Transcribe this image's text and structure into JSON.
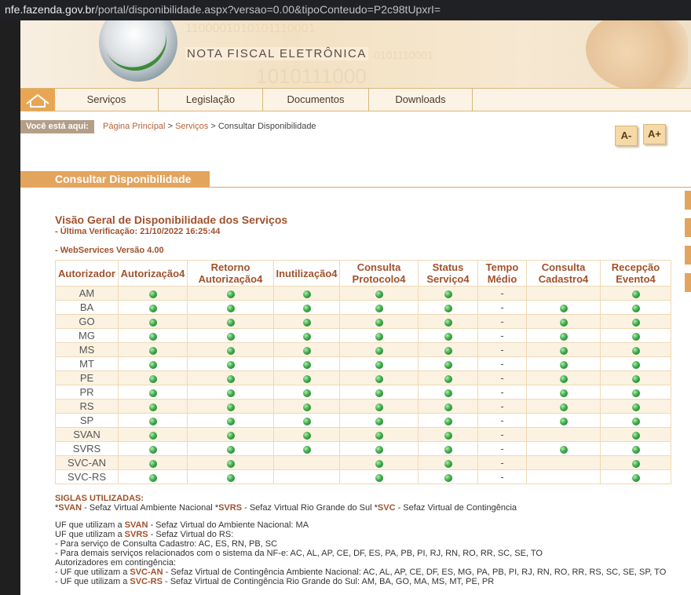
{
  "browser": {
    "url_domain": "nfe.fazenda.gov.br",
    "url_path": "/portal/disponibilidade.aspx?versao=0.00&tipoConteudo=P2c98tUpxrI="
  },
  "banner": {
    "title": "NOTA FISCAL ELETRÔNICA",
    "binary_1": "1100001010101110001",
    "binary_2": "0101110001",
    "binary_3": "1010111000"
  },
  "nav": {
    "home_icon": "house-icon",
    "items": [
      "Serviços",
      "Legislação",
      "Documentos",
      "Downloads"
    ]
  },
  "breadcrumb": {
    "label": "Você está aqui:",
    "links": [
      "Página Principal",
      "Serviços"
    ],
    "separator": ">",
    "current": "Consultar Disponibilidade"
  },
  "font_controls": {
    "decrease": "A-",
    "increase": "A+"
  },
  "section": {
    "title": "Consultar Disponibilidade"
  },
  "overview": {
    "heading": "Visão Geral de Disponibilidade dos Serviços",
    "last_check": "- Última Verificação: 21/10/2022 16:25:44",
    "version": "- WebServices Versão 4.00"
  },
  "table": {
    "headers": [
      "Autorizador",
      "Autorização4",
      "Retorno Autorização4",
      "Inutilização4",
      "Consulta Protocolo4",
      "Status Serviço4",
      "Tempo Médio",
      "Consulta Cadastro4",
      "Recepção Evento4"
    ],
    "rows": [
      {
        "uf": "AM",
        "cells": [
          "ok",
          "ok",
          "ok",
          "ok",
          "ok",
          "-",
          "",
          "ok"
        ]
      },
      {
        "uf": "BA",
        "cells": [
          "ok",
          "ok",
          "ok",
          "ok",
          "ok",
          "-",
          "ok",
          "ok"
        ]
      },
      {
        "uf": "GO",
        "cells": [
          "ok",
          "ok",
          "ok",
          "ok",
          "ok",
          "-",
          "ok",
          "ok"
        ]
      },
      {
        "uf": "MG",
        "cells": [
          "ok",
          "ok",
          "ok",
          "ok",
          "ok",
          "-",
          "ok",
          "ok"
        ]
      },
      {
        "uf": "MS",
        "cells": [
          "ok",
          "ok",
          "ok",
          "ok",
          "ok",
          "-",
          "ok",
          "ok"
        ]
      },
      {
        "uf": "MT",
        "cells": [
          "ok",
          "ok",
          "ok",
          "ok",
          "ok",
          "-",
          "ok",
          "ok"
        ]
      },
      {
        "uf": "PE",
        "cells": [
          "ok",
          "ok",
          "ok",
          "ok",
          "ok",
          "-",
          "ok",
          "ok"
        ]
      },
      {
        "uf": "PR",
        "cells": [
          "ok",
          "ok",
          "ok",
          "ok",
          "ok",
          "-",
          "ok",
          "ok"
        ]
      },
      {
        "uf": "RS",
        "cells": [
          "ok",
          "ok",
          "ok",
          "ok",
          "ok",
          "-",
          "ok",
          "ok"
        ]
      },
      {
        "uf": "SP",
        "cells": [
          "ok",
          "ok",
          "ok",
          "ok",
          "ok",
          "-",
          "ok",
          "ok"
        ]
      },
      {
        "uf": "SVAN",
        "cells": [
          "ok",
          "ok",
          "ok",
          "ok",
          "ok",
          "-",
          "",
          "ok"
        ]
      },
      {
        "uf": "SVRS",
        "cells": [
          "ok",
          "ok",
          "ok",
          "ok",
          "ok",
          "-",
          "ok",
          "ok"
        ]
      },
      {
        "uf": "SVC-AN",
        "cells": [
          "ok",
          "ok",
          "",
          "ok",
          "ok",
          "-",
          "",
          "ok"
        ]
      },
      {
        "uf": "SVC-RS",
        "cells": [
          "ok",
          "ok",
          "",
          "ok",
          "ok",
          "-",
          "",
          "ok"
        ]
      }
    ]
  },
  "notes": {
    "siglas_title": "SIGLAS UTILIZADAS:",
    "siglas_line": [
      {
        "pre": "*",
        "code": "SVAN",
        "desc": " - Sefaz Virtual Ambiente Nacional "
      },
      {
        "pre": "*",
        "code": "SVRS",
        "desc": " - Sefaz Virtual Rio Grande do Sul "
      },
      {
        "pre": "*",
        "code": "SVC",
        "desc": " - Sefaz Virtual de Contingência"
      }
    ],
    "svan_line": {
      "pre": "UF que utilizam a ",
      "code": "SVAN",
      "post": " - Sefaz Virtual do Ambiente Nacional: MA"
    },
    "svrs_line": {
      "pre": "UF que utilizam a ",
      "code": "SVRS",
      "post": " - Sefaz Virtual do RS:"
    },
    "svrs_cadastro": "- Para serviço de Consulta Cadastro: AC, ES, RN, PB, SC",
    "svrs_demais": "- Para demais serviços relacionados com o sistema da NF-e: AC, AL, AP, CE, DF, ES, PA, PB, PI, RJ, RN, RO, RR, SC, SE, TO",
    "contingencia_title": "Autorizadores em contingência:",
    "svcan_line": {
      "pre": "- UF que utilizam a ",
      "code": "SVC-AN",
      "post": " - Sefaz Virtual de Contingência Ambiente Nacional: AC, AL, AP, CE, DF, ES, MG, PA, PB, PI, RJ, RN, RO, RR, RS, SC, SE, SP, TO"
    },
    "svcrs_line": {
      "pre": "- UF que utilizam a ",
      "code": "SVC-RS",
      "post": " - Sefaz Virtual de Contingência Rio Grande do Sul: AM, BA, GO, MA, MS, MT, PE, PR"
    }
  },
  "colors": {
    "accent": "#e3a45e",
    "heading": "#a0522d",
    "status_ok": "#3fae4a",
    "row_alt": "#fcf2e2"
  }
}
